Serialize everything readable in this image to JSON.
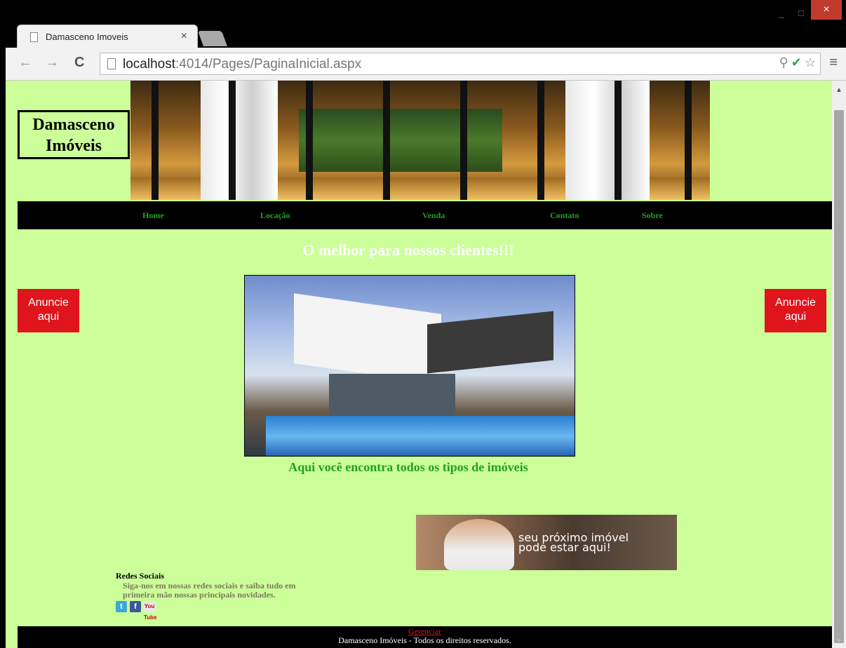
{
  "browser": {
    "tab_title": "Damasceno Imoveis",
    "tab_close": "×",
    "url_host": "localhost",
    "url_path": ":4014/Pages/PaginaInicial.aspx",
    "window_minimize": "_",
    "window_maximize": "□",
    "window_close": "×"
  },
  "header": {
    "logo_line1": "Damasceno",
    "logo_line2": "Imóveis"
  },
  "nav": {
    "items": [
      {
        "label": "Home"
      },
      {
        "label": "Locação"
      },
      {
        "label": "Venda"
      },
      {
        "label": "Contato"
      },
      {
        "label": "Sobre"
      }
    ]
  },
  "main": {
    "headline": "O melhor para nossos clientes!!!",
    "tagline": "Aqui você encontra todos os tipos de imóveis",
    "ad_left": "Anuncie aqui",
    "ad_right": "Anuncie aqui",
    "banner_line1": "seu próximo imóvel",
    "banner_line2": "pode estar aqui!"
  },
  "social": {
    "title": "Redes Sociais",
    "desc": "Siga-nos em nossas redes sociais e saiba tudo em primeira mão nossas principais novidades.",
    "twitter": "t",
    "facebook": "f",
    "youtube": "You Tube"
  },
  "footer": {
    "link": "Gerenciar",
    "copyright": "Damasceno Imóveis - Todos os direitos reservados."
  },
  "colors": {
    "page_bg": "#ccff99",
    "nav_link": "#22a022",
    "ad_red": "#e0141d"
  }
}
